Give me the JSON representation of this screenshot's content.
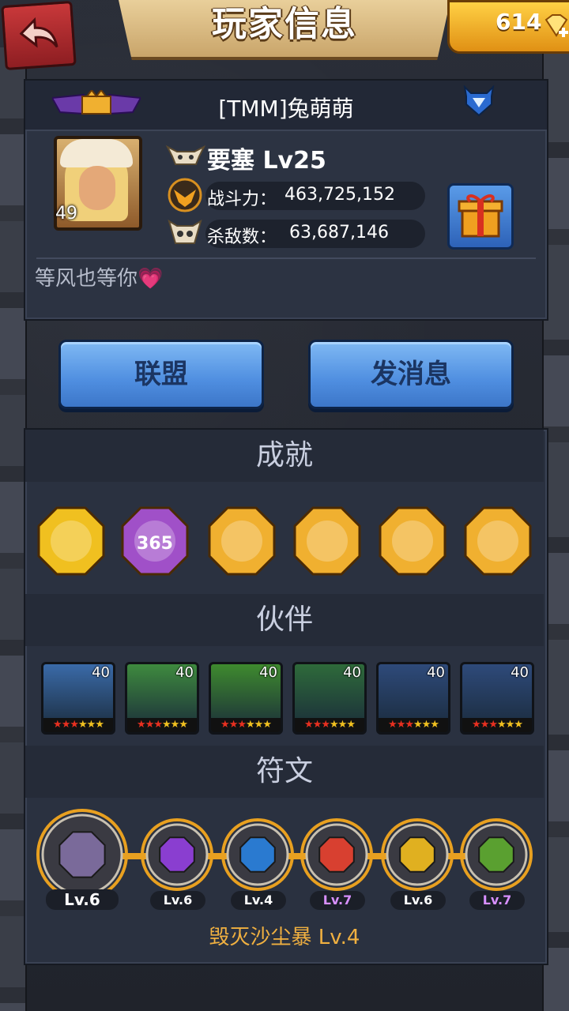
{
  "header": {
    "title": "玩家信息",
    "gems": "614"
  },
  "profile": {
    "name": "[TMM]兔萌萌",
    "avatar_level": "49",
    "fortress": "要塞 Lv25",
    "power_label": "战斗力：",
    "power_value": "463,725,152",
    "kills_label": "杀敌数：",
    "kills_value": "63,687,146",
    "signature": "等风也等你💗"
  },
  "buttons": {
    "alliance": "联盟",
    "message": "发消息"
  },
  "sections": {
    "achievements": "成就",
    "partners": "伙伴",
    "runes": "符文"
  },
  "achievements": [
    {
      "name": "gold-achievement-icon",
      "color": "#f0c020"
    },
    {
      "name": "calendar-365-icon",
      "color": "#a050c8",
      "text": "365"
    },
    {
      "name": "ice-beast-icon",
      "color": "#f0b030"
    },
    {
      "name": "sun-gear-icon",
      "color": "#f0b030"
    },
    {
      "name": "sack-upgrade-icon",
      "color": "#f0b030"
    },
    {
      "name": "caveman-face-icon",
      "color": "#f0b030"
    }
  ],
  "partners": [
    {
      "level": "40",
      "stars": "★★★★★★",
      "color": "#3a6aa8"
    },
    {
      "level": "40",
      "stars": "★★★★★★",
      "color": "#3e8a3e"
    },
    {
      "level": "40",
      "stars": "★★★★★★",
      "color": "#3e8a2e"
    },
    {
      "level": "40",
      "stars": "★★★★★★",
      "color": "#2e6a3a"
    },
    {
      "level": "40",
      "stars": "★★★★★★",
      "color": "#2e4a7a"
    },
    {
      "level": "40",
      "stars": "★★★★★★",
      "color": "#2e4a7a"
    }
  ],
  "runes": [
    {
      "level": "Lv.6",
      "color": "#7a6a9a",
      "label_color": "#ffffff"
    },
    {
      "level": "Lv.6",
      "color": "#8a3ed0",
      "label_color": "#ffffff"
    },
    {
      "level": "Lv.4",
      "color": "#2a7ad0",
      "label_color": "#ffffff"
    },
    {
      "level": "Lv.7",
      "color": "#d84030",
      "label_color": "#d890ff"
    },
    {
      "level": "Lv.6",
      "color": "#e0b020",
      "label_color": "#ffffff"
    },
    {
      "level": "Lv.7",
      "color": "#5aa030",
      "label_color": "#d890ff"
    }
  ],
  "rune_skill": "毁灭沙尘暴 Lv.4"
}
